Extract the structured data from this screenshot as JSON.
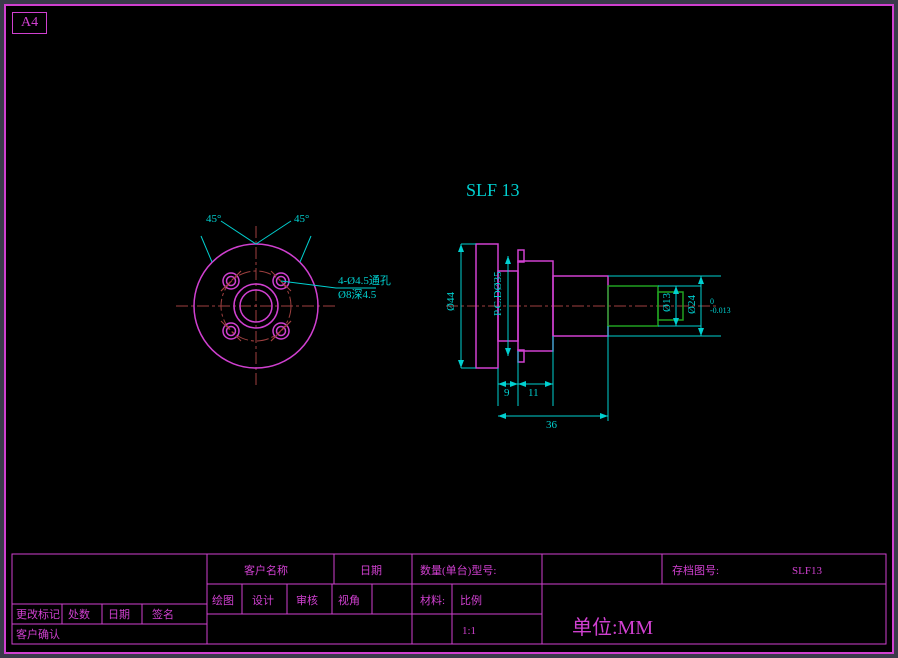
{
  "sheet": {
    "size": "A4"
  },
  "part": {
    "title": "SLF 13"
  },
  "front": {
    "angle1": "45°",
    "angle2": "45°",
    "hole_note": "4-Ø4.5通孔",
    "cbore_note": "Ø8深4.5"
  },
  "side": {
    "dia_outer": "Ø44",
    "dia_pcd": "P.C.DØ35",
    "dia_shaft": "Ø13",
    "dia_tip": "Ø24",
    "tol_tip": "0\n-0.013",
    "len_a": "9",
    "len_b": "11",
    "len_total": "36"
  },
  "title_block": {
    "customer": "客户名称",
    "date": "日期",
    "qty_model": "数量(单台)型号:",
    "archive": "存档图号:",
    "archive_val": "SLF13",
    "material": "材料:",
    "rev_mark": "更改标记",
    "dept": "处数",
    "rev_date": "日期",
    "sign": "签名",
    "confirm": "客户确认",
    "draw": "绘图",
    "design": "设计",
    "check": "审核",
    "view": "视角",
    "scale": "比例",
    "scale_val": "1:1",
    "unit": "单位:MM"
  }
}
